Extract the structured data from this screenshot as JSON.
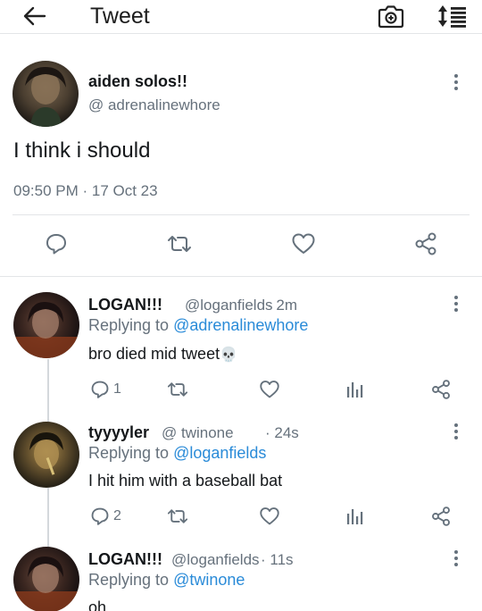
{
  "header": {
    "title": "Tweet"
  },
  "tweet": {
    "author_name": "aiden solos!!",
    "author_handle": "@ adrenalinewhore",
    "text": "I think i should",
    "timestamp": "09:50 PM · 17 Oct 23"
  },
  "replies": [
    {
      "name": "LOGAN!!!",
      "handle": "@loganfields",
      "time": "· 2m",
      "replying_prefix": "Replying to ",
      "replying_to": "@adrenalinewhore",
      "text": "bro died mid tweet",
      "emoji": "💀",
      "reply_count": "1"
    },
    {
      "name": "tyyyyler",
      "handle": "@ twinone",
      "time": "· 24s",
      "replying_prefix": "Replying to ",
      "replying_to": "@loganfields",
      "text": "I hit him with a baseball bat",
      "reply_count": "2"
    },
    {
      "name": "LOGAN!!!",
      "handle": "@loganfields",
      "time": "· 11s",
      "replying_prefix": "Replying to ",
      "replying_to": "@twinone",
      "text": "oh"
    }
  ],
  "colors": {
    "accent": "#2a8bd8",
    "muted": "#66717c",
    "icon": "#65717c"
  }
}
